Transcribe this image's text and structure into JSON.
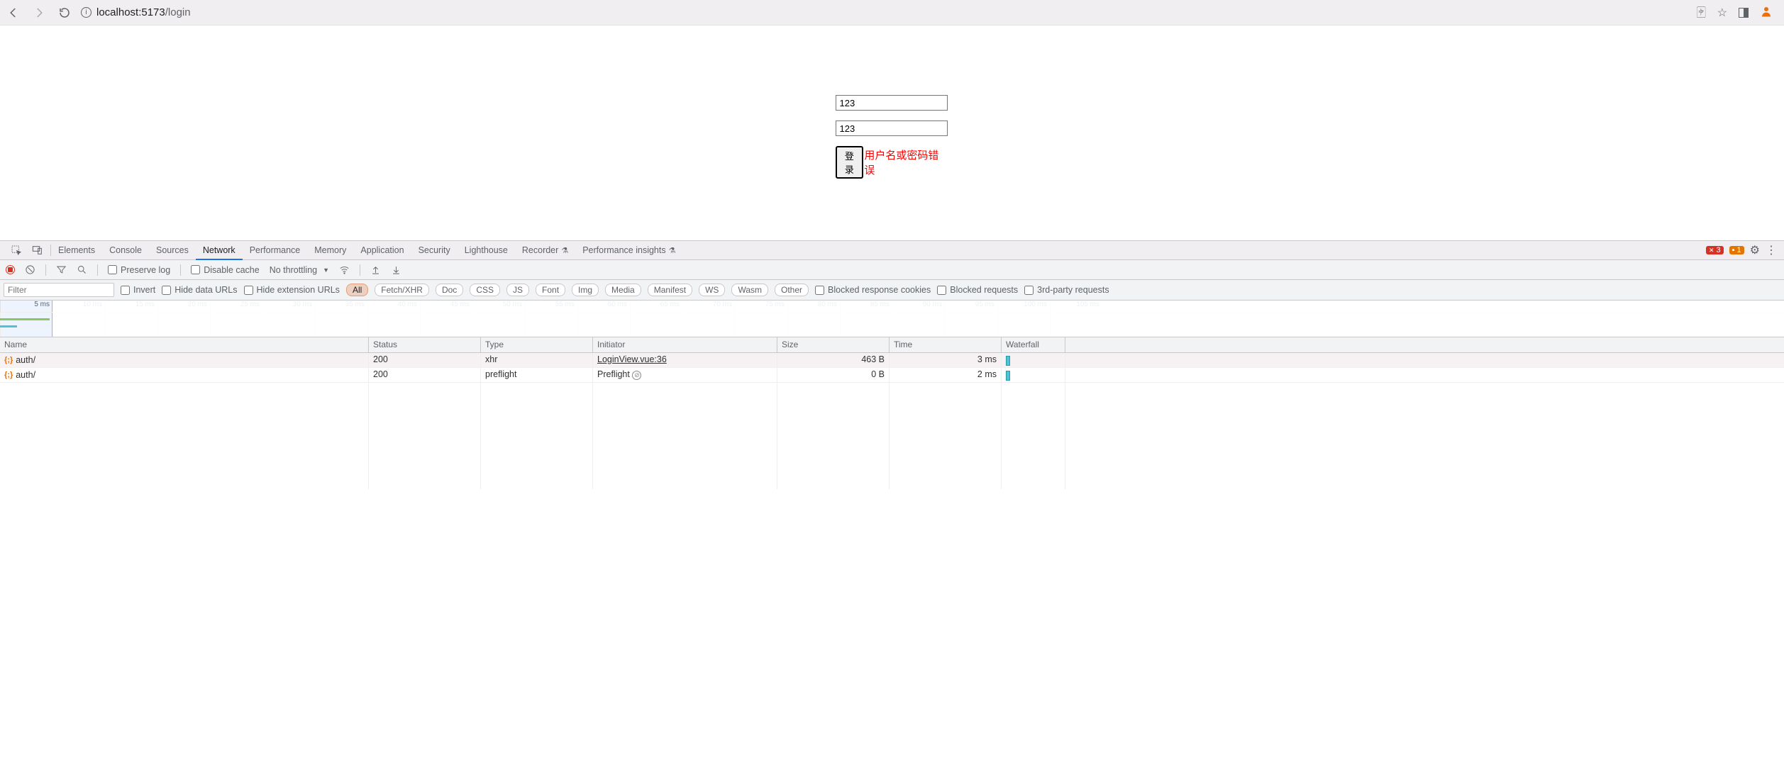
{
  "browser": {
    "url_host": "localhost:5173",
    "url_path": "/login"
  },
  "login": {
    "username_value": "123",
    "password_value": "123",
    "submit_label": "登录",
    "error_text": "用户名或密码错误"
  },
  "devtools": {
    "tabs": [
      "Elements",
      "Console",
      "Sources",
      "Network",
      "Performance",
      "Memory",
      "Application",
      "Security",
      "Lighthouse",
      "Recorder",
      "Performance insights"
    ],
    "active_tab": "Network",
    "error_count": "3",
    "warn_count": "1",
    "toolbar": {
      "preserve_log": "Preserve log",
      "disable_cache": "Disable cache",
      "throttling": "No throttling"
    },
    "filter": {
      "placeholder": "Filter",
      "invert": "Invert",
      "hide_data_urls": "Hide data URLs",
      "hide_ext_urls": "Hide extension URLs",
      "types": [
        "All",
        "Fetch/XHR",
        "Doc",
        "CSS",
        "JS",
        "Font",
        "Img",
        "Media",
        "Manifest",
        "WS",
        "Wasm",
        "Other"
      ],
      "active_type": "All",
      "blocked_cookies": "Blocked response cookies",
      "blocked_requests": "Blocked requests",
      "third_party": "3rd-party requests"
    },
    "timeline_ticks": [
      "5 ms",
      "10 ms",
      "15 ms",
      "20 ms",
      "25 ms",
      "30 ms",
      "35 ms",
      "40 ms",
      "45 ms",
      "50 ms",
      "55 ms",
      "60 ms",
      "65 ms",
      "70 ms",
      "75 ms",
      "80 ms",
      "85 ms",
      "90 ms",
      "95 ms",
      "100 ms",
      "105 ms"
    ],
    "columns": [
      "Name",
      "Status",
      "Type",
      "Initiator",
      "Size",
      "Time",
      "Waterfall"
    ],
    "requests": [
      {
        "name": "auth/",
        "status": "200",
        "type": "xhr",
        "initiator": "LoginView.vue:36",
        "initiator_link": true,
        "size": "463 B",
        "time": "3 ms"
      },
      {
        "name": "auth/",
        "status": "200",
        "type": "preflight",
        "initiator": "Preflight",
        "initiator_link": false,
        "size": "0 B",
        "time": "2 ms"
      }
    ]
  }
}
